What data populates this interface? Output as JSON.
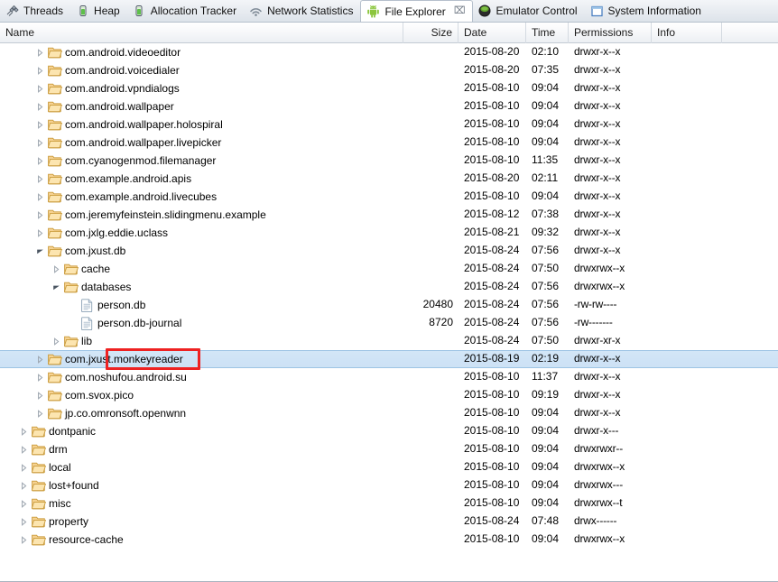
{
  "tabs": [
    {
      "label": "Threads",
      "icon": "threads-icon",
      "active": false,
      "closable": false
    },
    {
      "label": "Heap",
      "icon": "heap-icon",
      "active": false,
      "closable": false
    },
    {
      "label": "Allocation Tracker",
      "icon": "allocation-tracker-icon",
      "active": false,
      "closable": false
    },
    {
      "label": "Network Statistics",
      "icon": "network-statistics-icon",
      "active": false,
      "closable": false
    },
    {
      "label": "File Explorer",
      "icon": "android-icon",
      "active": true,
      "closable": true,
      "close_glyph": "⌧"
    },
    {
      "label": "Emulator Control",
      "icon": "emulator-control-icon",
      "active": false,
      "closable": false
    },
    {
      "label": "System Information",
      "icon": "system-information-icon",
      "active": false,
      "closable": false
    }
  ],
  "columns": [
    {
      "key": "name",
      "label": "Name"
    },
    {
      "key": "size",
      "label": "Size"
    },
    {
      "key": "date",
      "label": "Date"
    },
    {
      "key": "time",
      "label": "Time"
    },
    {
      "key": "permissions",
      "label": "Permissions"
    },
    {
      "key": "info",
      "label": "Info"
    }
  ],
  "selection": {
    "selected_row_index": 17,
    "annotation_color": "#ee2222"
  },
  "rows": [
    {
      "name": "com.android.videoeditor",
      "indent": 2,
      "type": "folder",
      "expander": "collapsed",
      "size": "",
      "date": "2015-08-20",
      "time": "02:10",
      "permissions": "drwxr-x--x",
      "info": ""
    },
    {
      "name": "com.android.voicedialer",
      "indent": 2,
      "type": "folder",
      "expander": "collapsed",
      "size": "",
      "date": "2015-08-20",
      "time": "07:35",
      "permissions": "drwxr-x--x",
      "info": ""
    },
    {
      "name": "com.android.vpndialogs",
      "indent": 2,
      "type": "folder",
      "expander": "collapsed",
      "size": "",
      "date": "2015-08-10",
      "time": "09:04",
      "permissions": "drwxr-x--x",
      "info": ""
    },
    {
      "name": "com.android.wallpaper",
      "indent": 2,
      "type": "folder",
      "expander": "collapsed",
      "size": "",
      "date": "2015-08-10",
      "time": "09:04",
      "permissions": "drwxr-x--x",
      "info": ""
    },
    {
      "name": "com.android.wallpaper.holospiral",
      "indent": 2,
      "type": "folder",
      "expander": "collapsed",
      "size": "",
      "date": "2015-08-10",
      "time": "09:04",
      "permissions": "drwxr-x--x",
      "info": ""
    },
    {
      "name": "com.android.wallpaper.livepicker",
      "indent": 2,
      "type": "folder",
      "expander": "collapsed",
      "size": "",
      "date": "2015-08-10",
      "time": "09:04",
      "permissions": "drwxr-x--x",
      "info": ""
    },
    {
      "name": "com.cyanogenmod.filemanager",
      "indent": 2,
      "type": "folder",
      "expander": "collapsed",
      "size": "",
      "date": "2015-08-10",
      "time": "11:35",
      "permissions": "drwxr-x--x",
      "info": ""
    },
    {
      "name": "com.example.android.apis",
      "indent": 2,
      "type": "folder",
      "expander": "collapsed",
      "size": "",
      "date": "2015-08-20",
      "time": "02:11",
      "permissions": "drwxr-x--x",
      "info": ""
    },
    {
      "name": "com.example.android.livecubes",
      "indent": 2,
      "type": "folder",
      "expander": "collapsed",
      "size": "",
      "date": "2015-08-10",
      "time": "09:04",
      "permissions": "drwxr-x--x",
      "info": ""
    },
    {
      "name": "com.jeremyfeinstein.slidingmenu.example",
      "indent": 2,
      "type": "folder",
      "expander": "collapsed",
      "size": "",
      "date": "2015-08-12",
      "time": "07:38",
      "permissions": "drwxr-x--x",
      "info": ""
    },
    {
      "name": "com.jxlg.eddie.uclass",
      "indent": 2,
      "type": "folder",
      "expander": "collapsed",
      "size": "",
      "date": "2015-08-21",
      "time": "09:32",
      "permissions": "drwxr-x--x",
      "info": ""
    },
    {
      "name": "com.jxust.db",
      "indent": 2,
      "type": "folder",
      "expander": "expanded",
      "size": "",
      "date": "2015-08-24",
      "time": "07:56",
      "permissions": "drwxr-x--x",
      "info": ""
    },
    {
      "name": "cache",
      "indent": 3,
      "type": "folder",
      "expander": "collapsed",
      "size": "",
      "date": "2015-08-24",
      "time": "07:50",
      "permissions": "drwxrwx--x",
      "info": ""
    },
    {
      "name": "databases",
      "indent": 3,
      "type": "folder",
      "expander": "expanded",
      "size": "",
      "date": "2015-08-24",
      "time": "07:56",
      "permissions": "drwxrwx--x",
      "info": ""
    },
    {
      "name": "person.db",
      "indent": 4,
      "type": "file",
      "expander": "none",
      "size": "20480",
      "date": "2015-08-24",
      "time": "07:56",
      "permissions": "-rw-rw----",
      "info": ""
    },
    {
      "name": "person.db-journal",
      "indent": 4,
      "type": "file",
      "expander": "none",
      "size": "8720",
      "date": "2015-08-24",
      "time": "07:56",
      "permissions": "-rw-------",
      "info": ""
    },
    {
      "name": "lib",
      "indent": 3,
      "type": "folder",
      "expander": "collapsed",
      "size": "",
      "date": "2015-08-24",
      "time": "07:50",
      "permissions": "drwxr-xr-x",
      "info": ""
    },
    {
      "name": "com.jxust.monkeyreader",
      "indent": 2,
      "type": "folder",
      "expander": "collapsed",
      "size": "",
      "date": "2015-08-19",
      "time": "02:19",
      "permissions": "drwxr-x--x",
      "info": ""
    },
    {
      "name": "com.noshufou.android.su",
      "indent": 2,
      "type": "folder",
      "expander": "collapsed",
      "size": "",
      "date": "2015-08-10",
      "time": "11:37",
      "permissions": "drwxr-x--x",
      "info": ""
    },
    {
      "name": "com.svox.pico",
      "indent": 2,
      "type": "folder",
      "expander": "collapsed",
      "size": "",
      "date": "2015-08-10",
      "time": "09:19",
      "permissions": "drwxr-x--x",
      "info": ""
    },
    {
      "name": "jp.co.omronsoft.openwnn",
      "indent": 2,
      "type": "folder",
      "expander": "collapsed",
      "size": "",
      "date": "2015-08-10",
      "time": "09:04",
      "permissions": "drwxr-x--x",
      "info": ""
    },
    {
      "name": "dontpanic",
      "indent": 1,
      "type": "folder",
      "expander": "collapsed",
      "size": "",
      "date": "2015-08-10",
      "time": "09:04",
      "permissions": "drwxr-x---",
      "info": ""
    },
    {
      "name": "drm",
      "indent": 1,
      "type": "folder",
      "expander": "collapsed",
      "size": "",
      "date": "2015-08-10",
      "time": "09:04",
      "permissions": "drwxrwxr--",
      "info": ""
    },
    {
      "name": "local",
      "indent": 1,
      "type": "folder",
      "expander": "collapsed",
      "size": "",
      "date": "2015-08-10",
      "time": "09:04",
      "permissions": "drwxrwx--x",
      "info": ""
    },
    {
      "name": "lost+found",
      "indent": 1,
      "type": "folder",
      "expander": "collapsed",
      "size": "",
      "date": "2015-08-10",
      "time": "09:04",
      "permissions": "drwxrwx---",
      "info": ""
    },
    {
      "name": "misc",
      "indent": 1,
      "type": "folder",
      "expander": "collapsed",
      "size": "",
      "date": "2015-08-10",
      "time": "09:04",
      "permissions": "drwxrwx--t",
      "info": ""
    },
    {
      "name": "property",
      "indent": 1,
      "type": "folder",
      "expander": "collapsed",
      "size": "",
      "date": "2015-08-24",
      "time": "07:48",
      "permissions": "drwx------",
      "info": ""
    },
    {
      "name": "resource-cache",
      "indent": 1,
      "type": "folder",
      "expander": "collapsed",
      "size": "",
      "date": "2015-08-10",
      "time": "09:04",
      "permissions": "drwxrwx--x",
      "info": ""
    }
  ]
}
